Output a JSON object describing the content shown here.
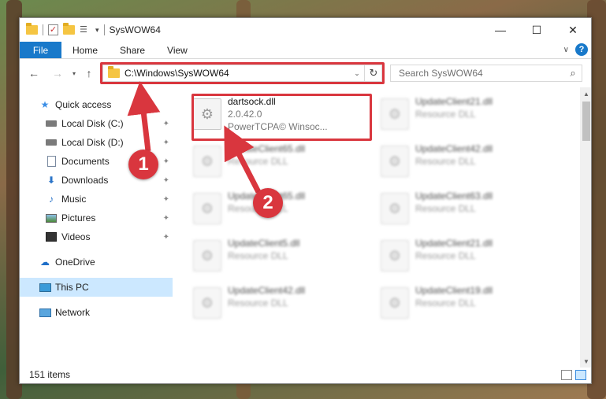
{
  "window": {
    "title": "SysWOW64",
    "controls": {
      "minimize": "—",
      "maximize": "☐",
      "close": "✕"
    }
  },
  "ribbon": {
    "tabs": [
      "File",
      "Home",
      "Share",
      "View"
    ],
    "help": "?"
  },
  "nav": {
    "address": "C:\\Windows\\SysWOW64",
    "search_placeholder": "Search SysWOW64"
  },
  "sidebar": {
    "items": [
      {
        "label": "Quick access",
        "icon": "star-icon"
      },
      {
        "label": "Local Disk (C:)",
        "icon": "drive-icon",
        "pinned": true
      },
      {
        "label": "Local Disk (D:)",
        "icon": "drive-icon",
        "pinned": true
      },
      {
        "label": "Documents",
        "icon": "documents-icon",
        "pinned": true
      },
      {
        "label": "Downloads",
        "icon": "download-icon",
        "pinned": true
      },
      {
        "label": "Music",
        "icon": "music-icon",
        "pinned": true
      },
      {
        "label": "Pictures",
        "icon": "pictures-icon",
        "pinned": true
      },
      {
        "label": "Videos",
        "icon": "videos-icon",
        "pinned": true
      },
      {
        "label": "OneDrive",
        "icon": "cloud-icon"
      },
      {
        "label": "This PC",
        "icon": "computer-icon",
        "selected": true
      },
      {
        "label": "Network",
        "icon": "network-icon"
      }
    ]
  },
  "files": [
    {
      "name": "dartsock.dll",
      "line1": "2.0.42.0",
      "line2": "PowerTCPA© Winsoc..."
    },
    {
      "name": "UpdateClient21.dll",
      "line1": "Resource DLL"
    },
    {
      "name": "UpdateClient65.dll",
      "line1": "Resource DLL"
    },
    {
      "name": "UpdateClient42.dll",
      "line1": "Resource DLL"
    },
    {
      "name": "UpdateClient65.dll",
      "line1": "Resource DLL"
    },
    {
      "name": "UpdateClient63.dll",
      "line1": "Resource DLL"
    },
    {
      "name": "UpdateClient5.dll",
      "line1": "Resource DLL"
    },
    {
      "name": "UpdateClient21.dll",
      "line1": "Resource DLL"
    },
    {
      "name": "UpdateClient42.dll",
      "line1": "Resource DLL"
    },
    {
      "name": "UpdateClient19.dll",
      "line1": "Resource DLL"
    }
  ],
  "status": {
    "count": "151 items"
  },
  "callouts": {
    "one": "1",
    "two": "2"
  },
  "colors": {
    "accent": "#1979ca",
    "highlight": "#d9363e",
    "selection": "#cce8ff"
  }
}
